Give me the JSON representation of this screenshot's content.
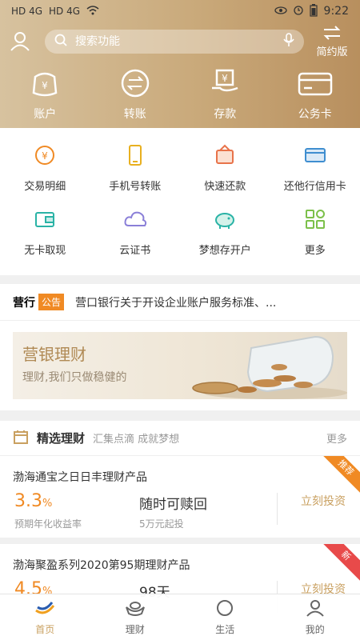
{
  "status": {
    "carrier1": "HD 4G",
    "carrier2": "HD 4G",
    "time": "9:22"
  },
  "header": {
    "search_placeholder": "搜索功能",
    "simple_mode_label": "简约版",
    "big_actions": [
      {
        "label": "账户",
        "icon": "wallet-icon"
      },
      {
        "label": "转账",
        "icon": "transfer-icon"
      },
      {
        "label": "存款",
        "icon": "deposit-icon"
      },
      {
        "label": "公务卡",
        "icon": "card-icon"
      }
    ]
  },
  "grid": [
    {
      "label": "交易明细",
      "icon": "transaction-icon"
    },
    {
      "label": "手机号转账",
      "icon": "phone-icon"
    },
    {
      "label": "快速还款",
      "icon": "repay-icon"
    },
    {
      "label": "还他行信用卡",
      "icon": "credit-card-icon"
    },
    {
      "label": "无卡取现",
      "icon": "cardless-icon"
    },
    {
      "label": "云证书",
      "icon": "cloud-icon"
    },
    {
      "label": "梦想存开户",
      "icon": "piggy-icon"
    },
    {
      "label": "更多",
      "icon": "more-icon"
    }
  ],
  "notice": {
    "label": "营行",
    "tag": "公告",
    "text": "营口银行关于开设企业账户服务标准、..."
  },
  "banner": {
    "title": "营银理财",
    "subtitle": "理财,我们只做稳健的"
  },
  "finance": {
    "title": "精选理财",
    "subtitle": "汇集点滴 成就梦想",
    "more": "更多",
    "products": [
      {
        "name": "渤海通宝之日日丰理财产品",
        "rate": "3.3",
        "rate_unit": "%",
        "rate_label": "预期年化收益率",
        "term": "随时可赎回",
        "min": "5万元起投",
        "action": "立刻投资",
        "corner": "推荐",
        "corner_color": "#f08a24"
      },
      {
        "name": "渤海聚盈系列2020第95期理财产品",
        "rate": "4.5",
        "rate_unit": "%",
        "rate_label": "",
        "term": "98天",
        "min": "",
        "action": "立刻投资",
        "corner": "新",
        "corner_color": "#e84a4a"
      }
    ]
  },
  "tabbar": [
    {
      "label": "首页",
      "active": true
    },
    {
      "label": "理财",
      "active": false
    },
    {
      "label": "生活",
      "active": false
    },
    {
      "label": "我的",
      "active": false
    }
  ]
}
